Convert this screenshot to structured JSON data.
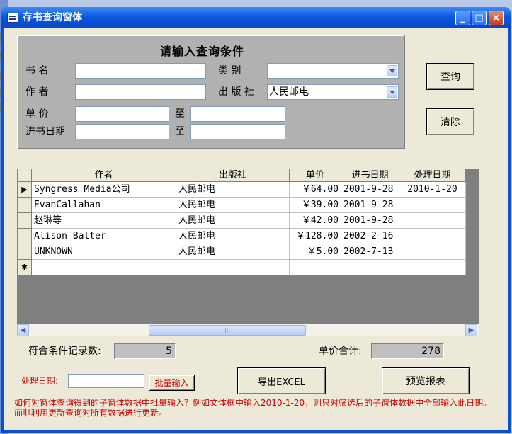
{
  "window": {
    "title": "存书查询窗体",
    "minimize_glyph": "_",
    "maximize_glyph": "□",
    "close_glyph": "×"
  },
  "query": {
    "heading": "请输入查询条件",
    "book_name_label": "书    名",
    "category_label": "类    别",
    "author_label": "作    者",
    "publisher_label": "出 版 社",
    "publisher_value": "人民邮电",
    "price_label": "单    价",
    "to_label": "至",
    "date_label": "进书日期",
    "date_to_label": "至"
  },
  "buttons": {
    "query": "查询",
    "clear": "清除",
    "batch_input": "批量输入",
    "export_excel": "导出EXCEL",
    "preview_report": "预览报表"
  },
  "grid": {
    "columns": [
      "作者",
      "出版社",
      "单价",
      "进书日期",
      "处理日期"
    ],
    "rows": [
      {
        "author": "Syngress Media公司",
        "publisher": "人民邮电",
        "price": "￥64.00",
        "in_date": "2001-9-28",
        "proc_date": "2010-1-20",
        "selector": "▶"
      },
      {
        "author": "EvanCallahan",
        "publisher": "人民邮电",
        "price": "￥39.00",
        "in_date": "2001-9-28",
        "proc_date": "",
        "selector": ""
      },
      {
        "author": "赵琳等",
        "publisher": "人民邮电",
        "price": "￥42.00",
        "in_date": "2001-9-28",
        "proc_date": "",
        "selector": ""
      },
      {
        "author": "Alison Balter",
        "publisher": "人民邮电",
        "price": "￥128.00",
        "in_date": "2002-2-16",
        "proc_date": "",
        "selector": ""
      },
      {
        "author": "UNKNOWN",
        "publisher": "人民邮电",
        "price": "￥5.00",
        "in_date": "2002-7-13",
        "proc_date": "",
        "selector": ""
      }
    ],
    "new_row_marker": "✱"
  },
  "summary": {
    "count_label": "符合条件记录数:",
    "count_value": "5",
    "total_label": "单价合计:",
    "total_value": "278"
  },
  "batch": {
    "label": "处理日期:",
    "value": ""
  },
  "note": {
    "line1": "如何对窗体查询得到的子窗体数据中批量输入？例如文体框中输入2010-1-20，则只对筛选后的子窗体数据中全部输入此日期。",
    "line2": "而非利用更新查询对所有数据进行更新。"
  },
  "colors": {
    "titlebar": "#0a58e0",
    "form_bg": "#ece9d8",
    "panel_bg": "#b1b1b1",
    "note_red": "#d00000"
  }
}
